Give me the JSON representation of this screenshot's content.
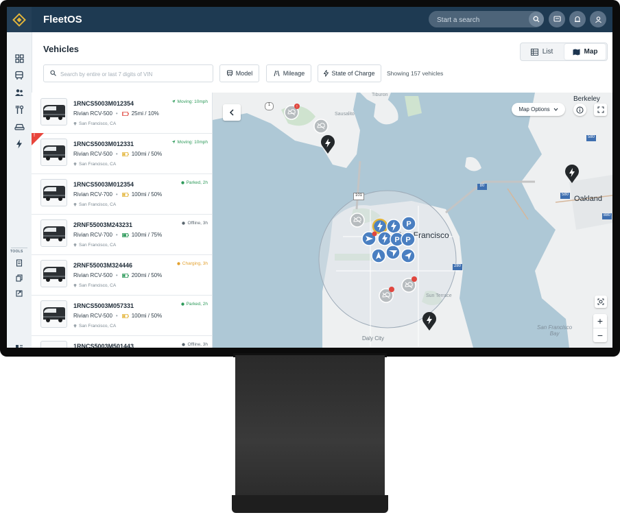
{
  "app": {
    "title": "FleetOS"
  },
  "topbar": {
    "search_placeholder": "Start a search"
  },
  "sidebar": {
    "tools_label": "TOOLS"
  },
  "page": {
    "title": "Vehicles"
  },
  "view_toggle": {
    "list_label": "List",
    "map_label": "Map",
    "active": "Map"
  },
  "filters": {
    "vin_placeholder": "Search by entire or last 7 digits of VIN",
    "model_label": "Model",
    "mileage_label": "Mileage",
    "charge_label": "State of Charge",
    "showing_text": "Showing 157 vehicles"
  },
  "vehicles": [
    {
      "vin": "1RNCS5003M012354",
      "model": "Rivian RCV-500",
      "charge": "25mi / 10%",
      "location": "San Francisco, CA",
      "status": "Moving: 10mph",
      "status_color": "#2e9a5a",
      "battery_color": "#e0473f",
      "battery_level": 0.1,
      "alert": false
    },
    {
      "vin": "1RNCS5003M012331",
      "model": "Rivian RCV-500",
      "charge": "100mi / 50%",
      "location": "San Francisco, CA",
      "status": "Moving: 10mph",
      "status_color": "#2e9a5a",
      "battery_color": "#e3b53a",
      "battery_level": 0.5,
      "alert": true
    },
    {
      "vin": "1RNCS5003M012354",
      "model": "Rivian RCV-700",
      "charge": "100mi / 50%",
      "location": "San Francisco, CA",
      "status": "Parked, 2h",
      "status_color": "#2e9a5a",
      "battery_color": "#e3b53a",
      "battery_level": 0.5,
      "alert": false
    },
    {
      "vin": "2RNF55003M243231",
      "model": "Rivian RCV-700",
      "charge": "100mi / 75%",
      "location": "San Francisco, CA",
      "status": "Offline, 3h",
      "status_color": "#5b6770",
      "battery_color": "#2e9a5a",
      "battery_level": 0.75,
      "alert": false
    },
    {
      "vin": "2RNF55003M324446",
      "model": "Rivian RCV-500",
      "charge": "200mi / 50%",
      "location": "San Francisco, CA",
      "status": "Charging, 3h",
      "status_color": "#e3a12f",
      "battery_color": "#2e9a5a",
      "battery_level": 0.5,
      "alert": false
    },
    {
      "vin": "1RNCS5003M057331",
      "model": "Rivian RCV-500",
      "charge": "100mi / 50%",
      "location": "San Francisco, CA",
      "status": "Parked, 2h",
      "status_color": "#2e9a5a",
      "battery_color": "#e3b53a",
      "battery_level": 0.5,
      "alert": false
    },
    {
      "vin": "1RNCS5003M501443",
      "model": "",
      "charge": "",
      "location": "",
      "status": "Offline, 3h",
      "status_color": "#5b6770",
      "battery_color": "#2e9a5a",
      "battery_level": 0.5,
      "alert": false
    }
  ],
  "map": {
    "options_label": "Map Options",
    "labels": {
      "berkeley": "Berkeley",
      "oakland": "Oakland",
      "san_francisco": "San Francisco",
      "daly_city": "Daly City",
      "sausalito": "Sausalito",
      "tiburon": "Tiburon",
      "sf_bay": "San Francisco\nBay",
      "sun_terrace": "Sun Terrace",
      "hwy_1": "1",
      "hwy_101": "101",
      "hwy_580": "580",
      "hwy_880": "880",
      "hwy_80": "80",
      "hwy_280": "280",
      "hwy_580b": "580"
    },
    "zoom_in": "+",
    "zoom_out": "−"
  },
  "colors": {
    "brand": "#1e3a52",
    "accent": "#e3b53a",
    "marker_blue": "#4a7fc1",
    "alert": "#e0473f"
  }
}
